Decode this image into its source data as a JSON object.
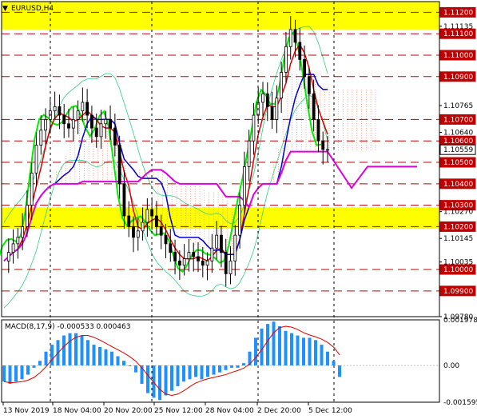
{
  "window_title": "EURUSD,H4",
  "title_marker": "▼",
  "macd": {
    "label": "MACD(8,17,9) -0.000533 0.000463",
    "axis_labels": [
      "0.001978",
      "0.00",
      "-0.001595"
    ]
  },
  "price_axis": {
    "labels": [
      "1.11200",
      "1.11135",
      "1.11100",
      "1.11000",
      "1.10900",
      "1.10765",
      "1.10700",
      "1.10640",
      "1.10600",
      "1.10559",
      "1.10500",
      "1.10400",
      "1.10300",
      "1.10270",
      "1.10200",
      "1.10145",
      "1.10035",
      "1.10000",
      "1.09900",
      "1.09780"
    ],
    "boxed_labels": [
      "1.11200",
      "1.11100",
      "1.11000",
      "1.10900",
      "1.10700",
      "1.10600",
      "1.10559",
      "1.10500",
      "1.10400",
      "1.10300",
      "1.10200",
      "1.10000",
      "1.09900"
    ]
  },
  "time_axis": {
    "labels": [
      "13 Nov 2019",
      "18 Nov 04:00",
      "20 Nov 20:00",
      "25 Nov 12:00",
      "28 Nov 04:00",
      "2 Dec 20:00",
      "5 Dec 12:00"
    ]
  },
  "colors": {
    "background": "#ffffff",
    "resistance_zone": "#ffff00",
    "level_line": "#c00000",
    "current_price_box": "#000000",
    "candle": "#000000",
    "green_line": "#00ee00",
    "red_line": "#dd0000",
    "blue_line": "#0000cc",
    "magenta_line": "#dd00dd",
    "macd_histogram": "#1e90ff",
    "macd_signal": "#dd0000",
    "envelope": "#33cc88",
    "cloud_dots": "#ff8c69"
  },
  "chart_data": {
    "type": "candlestick",
    "title": "EURUSD,H4",
    "symbol": "EURUSD",
    "timeframe": "H4",
    "ylim": [
      1.0978,
      1.1125
    ],
    "current_price": 1.10559,
    "horizontal_levels": [
      1.112,
      1.111,
      1.11,
      1.109,
      1.107,
      1.106,
      1.105,
      1.104,
      1.103,
      1.102,
      1.1,
      1.099
    ],
    "highlighted_zones": [
      [
        1.1112,
        1.1125
      ],
      [
        1.1019,
        1.1029
      ]
    ],
    "close_series_approx": [
      1.1004,
      1.1008,
      1.1012,
      1.1015,
      1.102,
      1.103,
      1.1045,
      1.1058,
      1.1065,
      1.107,
      1.1074,
      1.1076,
      1.1072,
      1.1068,
      1.1066,
      1.107,
      1.1074,
      1.1078,
      1.1072,
      1.1066,
      1.1062,
      1.1068,
      1.107,
      1.1066,
      1.1058,
      1.104,
      1.1025,
      1.102,
      1.1015,
      1.1018,
      1.1022,
      1.1028,
      1.1025,
      1.102,
      1.1016,
      1.1012,
      1.1008,
      1.1004,
      1.1002,
      1.1005,
      1.1008,
      1.1006,
      1.1004,
      1.1002,
      1.1004,
      1.101,
      1.1016,
      1.1008,
      1.0998,
      1.1004,
      1.1016,
      1.103,
      1.1048,
      1.106,
      1.1072,
      1.1078,
      1.1082,
      1.1076,
      1.107,
      1.108,
      1.1092,
      1.1104,
      1.1112,
      1.1106,
      1.1098,
      1.109,
      1.1082,
      1.107,
      1.106,
      1.1056,
      1.1056
    ],
    "macd": {
      "name": "MACD(8,17,9)",
      "main": -0.000533,
      "signal": 0.000463,
      "ylim": [
        -0.001595,
        0.001978
      ],
      "histogram_approx": [
        -0.0007,
        -0.0008,
        -0.0007,
        -0.0006,
        -0.0004,
        -0.0001,
        0.0002,
        0.0006,
        0.0009,
        0.0011,
        0.0013,
        0.0014,
        0.0014,
        0.0013,
        0.0011,
        0.0009,
        0.0008,
        0.0007,
        0.0006,
        0.0004,
        0.0002,
        0.0,
        -0.0003,
        -0.0008,
        -0.0012,
        -0.0014,
        -0.0015,
        -0.0013,
        -0.0011,
        -0.0009,
        -0.0007,
        -0.0006,
        -0.0005,
        -0.0006,
        -0.0005,
        -0.0004,
        -0.0003,
        -0.0002,
        -0.0001,
        -0.0001,
        0.0001,
        0.0006,
        0.0012,
        0.0016,
        0.0018,
        0.0019,
        0.0017,
        0.0015,
        0.0014,
        0.0013,
        0.0012,
        0.0012,
        0.0011,
        0.0009,
        0.0006,
        0.0002,
        -0.0005
      ]
    }
  }
}
